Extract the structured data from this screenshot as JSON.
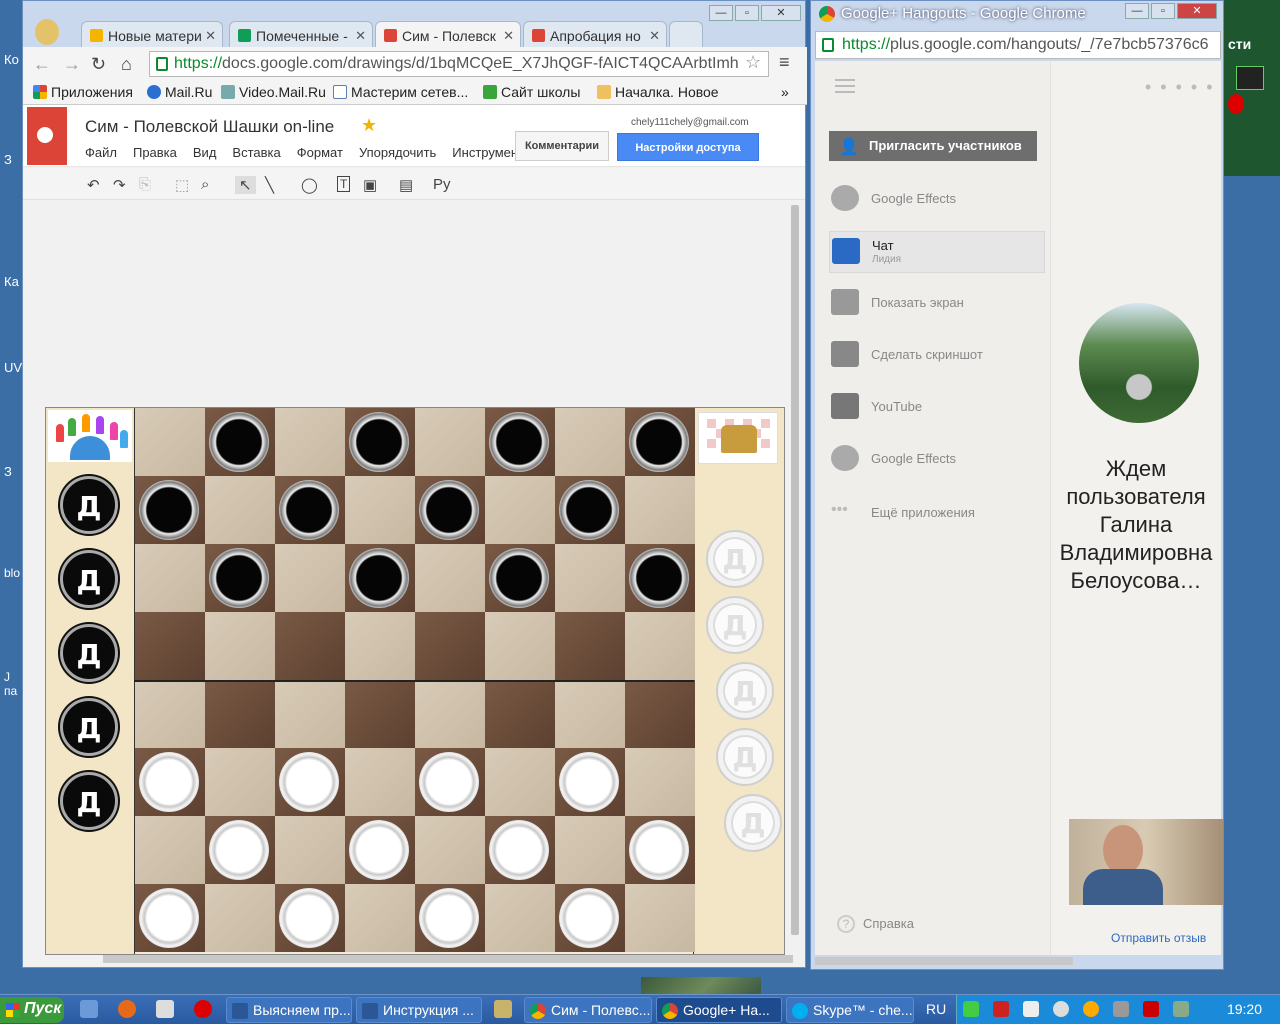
{
  "desktop": {
    "labels": [
      "Ко",
      "З",
      "Ка",
      "UV",
      "З",
      "blo",
      "J па"
    ]
  },
  "left_window": {
    "tabs": [
      {
        "label": "Новые матери",
        "icon_color": "#f4b400"
      },
      {
        "label": "Помеченные -",
        "icon_color": "#0f9d58"
      },
      {
        "label": "Сим - Полевск",
        "icon_color": "#db4437",
        "active": true
      },
      {
        "label": "Апробация но",
        "icon_color": "#db4437"
      }
    ],
    "window_buttons": [
      "—",
      "▫",
      "✕"
    ],
    "url_https": "https://",
    "url_rest": "docs.google.com/drawings/d/1bqMCQeE_X7JhQGF-fAICT4QCAArbtImh",
    "bookmarks": [
      "Приложения",
      "Mail.Ru",
      "Video.Mail.Ru",
      "Мастерим сетев...",
      "Сайт школы",
      "Началка. Новое"
    ],
    "bookmarks_more": "»",
    "doc": {
      "title": "Сим - Полевской Шашки on-line",
      "star": "★",
      "menu": [
        "Файл",
        "Правка",
        "Вид",
        "Вставка",
        "Формат",
        "Упорядочить",
        "Инструмен"
      ],
      "email": "chely111chely@gmail.com",
      "comments_label": "Комментарии",
      "share_label": "Настройки доступа",
      "toolbar": [
        "↶",
        "↷",
        "⎘",
        "⬚",
        "⌕",
        "↖",
        "╲",
        "◯",
        "T",
        "▣",
        "▤",
        "Ру"
      ],
      "board": {
        "black_rows": [
          [
            1,
            3,
            5,
            7
          ],
          [
            0,
            2,
            4,
            6
          ],
          [
            1,
            3,
            5,
            7
          ]
        ],
        "white_rows": [
          [
            0,
            2,
            4,
            6
          ],
          [
            1,
            3,
            5,
            7
          ],
          [
            0,
            2,
            4,
            6
          ]
        ],
        "left_kings": [
          "Д",
          "Д",
          "Д",
          "Д",
          "Д"
        ],
        "right_kings": [
          "Д",
          "Д",
          "Д",
          "Д",
          "Д"
        ]
      }
    }
  },
  "right_window": {
    "title": "Google+ Hangouts - Google Chrome",
    "url_https": "https://",
    "url_rest": "plus.google.com/hangouts/_/7e7bcb57376c6",
    "invite_label": "Пригласить участников",
    "apps": [
      {
        "label": "Google Effects",
        "icon": "effects-icon",
        "color": "#aaa"
      },
      {
        "label": "Чат",
        "sub": "Лидия",
        "icon": "chat-icon",
        "color": "#2a6ac4"
      },
      {
        "label": "Показать экран",
        "icon": "screen-icon",
        "color": "#999"
      },
      {
        "label": "Сделать скриншот",
        "icon": "camera-icon",
        "color": "#888"
      },
      {
        "label": "YouTube",
        "icon": "youtube-icon",
        "color": "#777"
      },
      {
        "label": "Google Effects",
        "icon": "effects-icon",
        "color": "#aaa"
      },
      {
        "label": "Ещё приложения",
        "icon": "more-icon",
        "color": "#bbb"
      }
    ],
    "waiting_text": "Ждем пользователя Галина Владимировна Белоусова…",
    "help_label": "Справка",
    "feedback_label": "Отправить отзыв",
    "more_dots": "• • • • •"
  },
  "taskbar": {
    "start_label": "Пуск",
    "tasks": [
      {
        "label": "Выясняем пр...",
        "color": "#2b5797"
      },
      {
        "label": "Инструкция ...",
        "color": "#2b5797"
      },
      {
        "label": "Сим - Полевс...",
        "color": "#db4437"
      },
      {
        "label": "Google+ Ha...",
        "color": "#db4437",
        "active": true
      },
      {
        "label": "Skype™ - che...",
        "color": "#00aff0"
      }
    ],
    "lang": "RU",
    "clock": "19:20"
  },
  "right_strip_text": "сти"
}
